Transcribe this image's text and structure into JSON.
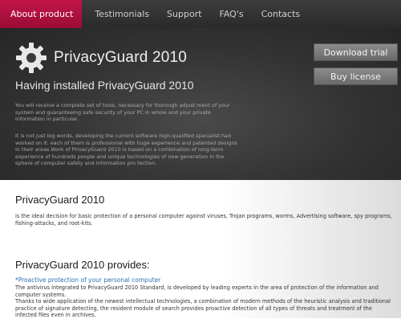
{
  "nav": {
    "items": [
      {
        "label": "About product",
        "active": true
      },
      {
        "label": "Testimonials"
      },
      {
        "label": "Support"
      },
      {
        "label": "FAQ's"
      },
      {
        "label": "Contacts"
      }
    ]
  },
  "hero": {
    "logo_icon": "gear-icon",
    "brand": "PrivacyGuard 2010",
    "download_label": "Download trial",
    "buy_label": "Buy license",
    "heading": "Having installed PrivacyGuard 2010",
    "p1": "You will receive a complete set of tools, necessary for thorough adjust ment of your system and guaranteeing safe security of your PC in whole and your private information in particular.",
    "p2": "It is not just big words, developing the current software high-qualified specialist had worked on it: each of them is professional with huge experience and patented designs in their areas.Work of PrivacyGuard 2010 is based on a combination of long-term experience of hundreds people and unique technologies of new generation in the sphere of computer safety and information pro tection."
  },
  "content": {
    "title1": "PrivacyGuard 2010",
    "desc1": "is the ideal decision for basic protection of a personal computer against viruses, Trojan programs, worms, Advertising software, spy programs, fishing-attacks, and root-kits.",
    "title2": "PrivacyGuard 2010 provides:",
    "feature1": "*Proactive protection of your personal computer",
    "feature1_desc": "The antivirus integrated to PrivacyGuard 2010 Standard, is developed by leading experts in the area of protection of the information and computer systems.",
    "feature1_desc2": "Thanks to wide application of the newest intellectual technologies, a combination of modern methods of the heuristic analysis and traditional practice of signature detecting, the resident module of search provides proactive detection of all types of threats and treatment of the infected files even in archives."
  },
  "colors": {
    "accent": "#b0113f",
    "link": "#2a6fb3",
    "nav_bg": "#333333"
  }
}
